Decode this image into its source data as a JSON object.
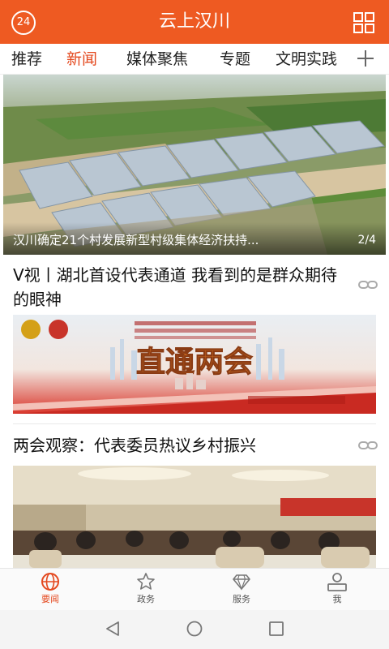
{
  "header": {
    "badge": "24",
    "title": "云上汉川"
  },
  "tabs": [
    "推荐",
    "新闻",
    "媒体聚焦",
    "专题",
    "文明实践"
  ],
  "active_tab": "新闻",
  "hero": {
    "caption": "汉川确定21个村发展新型村级集体经济扶持...",
    "pager": "2/4"
  },
  "articles": [
    {
      "title": "V视丨湖北首设代表通道 我看到的是群众期待的眼神",
      "banner_text": "直通两会"
    },
    {
      "title": "两会观察：代表委员热议乡村振兴"
    }
  ],
  "bottom_nav": [
    {
      "label": "要闻",
      "icon": "globe-icon",
      "active": true
    },
    {
      "label": "政务",
      "icon": "star-icon",
      "active": false
    },
    {
      "label": "服务",
      "icon": "diamond-icon",
      "active": false
    },
    {
      "label": "我",
      "icon": "person-icon",
      "active": false
    }
  ],
  "colors": {
    "accent": "#ee5a22",
    "active_text": "#e4491f"
  }
}
